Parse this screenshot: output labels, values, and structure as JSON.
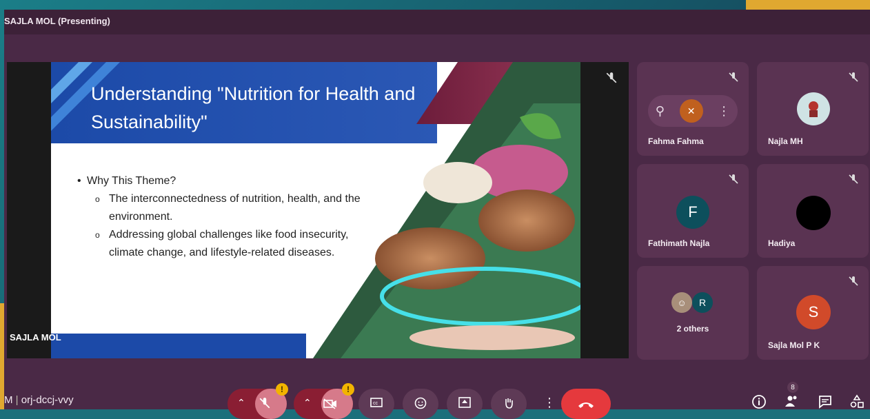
{
  "window": {
    "presenting_label": "SAJLA MOL (Presenting)"
  },
  "slide": {
    "title": "Understanding \"Nutrition for Health and Sustainability\"",
    "bullet_main": "Why This Theme?",
    "sub_bullets": [
      "The interconnectedness of nutrition, health, and the environment.",
      "Addressing global challenges like food insecurity, climate change, and lifestyle-related diseases."
    ]
  },
  "stage": {
    "presenter_name": "SAJLA MOL"
  },
  "participants": [
    {
      "name": "Fahma Fahma",
      "muted": true,
      "avatar": "orange-circle"
    },
    {
      "name": "Najla MH",
      "muted": true,
      "avatar": "cartoon"
    },
    {
      "name": "Fathimath Najla",
      "muted": true,
      "avatar_letter": "F",
      "color": "#0d4f5c"
    },
    {
      "name": "Hadiya",
      "muted": true,
      "avatar": "black-circle"
    },
    {
      "name": "2 others",
      "avatar_letter": "R"
    },
    {
      "name": "Sajla Mol P K",
      "muted": true,
      "avatar_letter": "S",
      "color": "#d14a2a"
    }
  ],
  "bottom": {
    "meeting_code_prefix": "M",
    "meeting_code": "orj-dccj-vvy",
    "people_count": "8",
    "warn_symbol": "!"
  },
  "colors": {
    "accent": "#e5393d",
    "warning": "#f2b400"
  }
}
